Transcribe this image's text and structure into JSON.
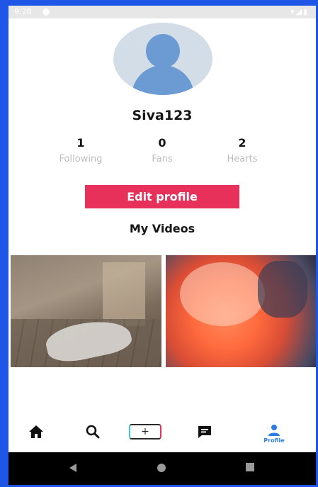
{
  "status_bar": {
    "time": "9:28",
    "right_icons": "▾◢▮"
  },
  "profile": {
    "username": "Siva123",
    "stats": [
      {
        "value": "1",
        "label": "Following"
      },
      {
        "value": "0",
        "label": "Fans"
      },
      {
        "value": "2",
        "label": "Hearts"
      }
    ],
    "edit_label": "Edit profile",
    "videos_title": "My Videos"
  },
  "tabbar": {
    "add_label": "+",
    "profile_label": "Profile"
  },
  "icons": {
    "home": "home-icon",
    "search": "search-icon",
    "add": "add-video-icon",
    "inbox": "message-icon",
    "profile": "person-icon"
  },
  "colors": {
    "accent": "#e8315a",
    "avatar": "#6b9bd2",
    "frame": "#1f56e6",
    "active_tab": "#2a7de1"
  }
}
